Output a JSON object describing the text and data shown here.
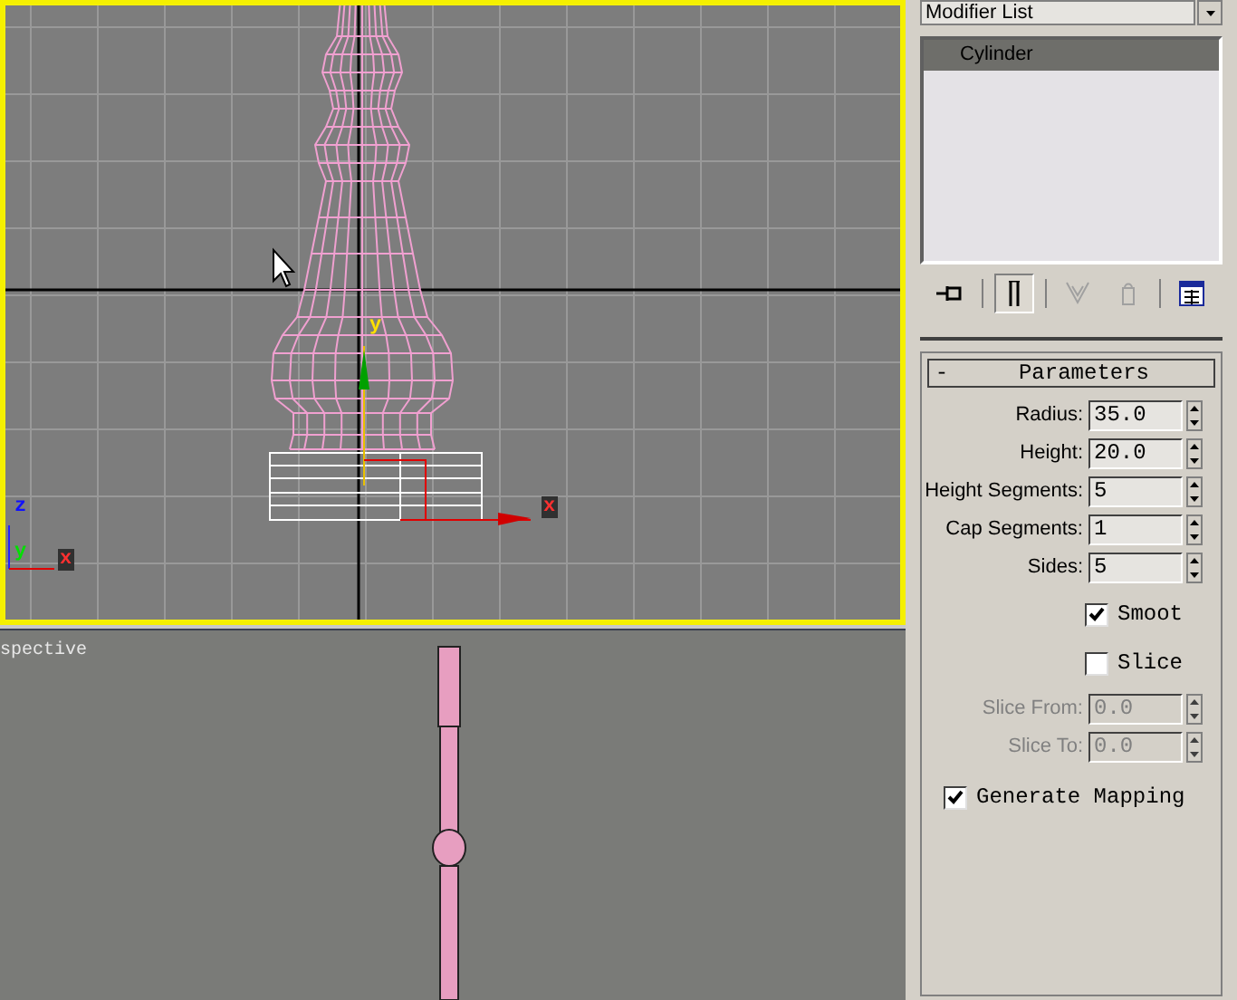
{
  "top_viewport": {
    "active": true,
    "gizmo": {
      "x_label": "x",
      "y_label": "y"
    },
    "tripod": {
      "z_label": "z",
      "y_label": "y",
      "x_label": "x"
    }
  },
  "bottom_viewport": {
    "label": "spective"
  },
  "modifier_panel": {
    "modifier_list": "Modifier List",
    "stack": [
      {
        "label": "Cylinder",
        "selected": true
      }
    ],
    "toolbar": [
      {
        "kind": "pin",
        "pressed": false,
        "disabled": false
      },
      {
        "kind": "end-result",
        "pressed": true,
        "disabled": false
      },
      {
        "kind": "unique",
        "pressed": false,
        "disabled": true
      },
      {
        "kind": "remove",
        "pressed": false,
        "disabled": true
      },
      {
        "kind": "configure",
        "pressed": false,
        "disabled": false
      }
    ]
  },
  "parameters": {
    "collapse": "-",
    "title": "Parameters",
    "fields": [
      {
        "label": "Radius:",
        "value": "35.0",
        "disabled": false
      },
      {
        "label": "Height:",
        "value": "20.0",
        "disabled": false
      },
      {
        "label": "Height Segments:",
        "value": "5",
        "disabled": false
      },
      {
        "label": "Cap Segments:",
        "value": "1",
        "disabled": false
      },
      {
        "label": "Sides:",
        "value": "5",
        "disabled": false
      }
    ],
    "checkboxes": [
      {
        "label": "Smoot",
        "checked": true
      },
      {
        "label": "Slice",
        "checked": false
      }
    ],
    "slice_fields": [
      {
        "label": "Slice From:",
        "value": "0.0",
        "disabled": true
      },
      {
        "label": "Slice To:",
        "value": "0.0",
        "disabled": true
      }
    ],
    "mapping": {
      "label": "Generate Mapping",
      "checked": true
    }
  }
}
